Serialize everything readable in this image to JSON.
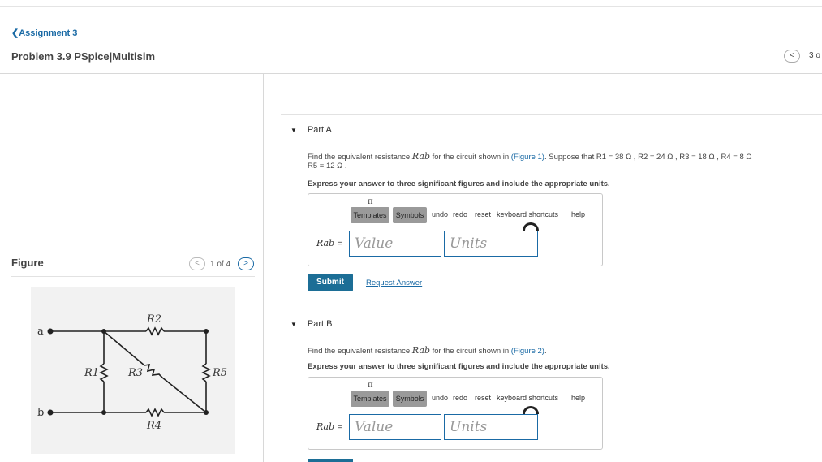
{
  "header": {
    "back_link": "❮Assignment 3",
    "title": "Problem 3.9 PSpice|Multisim",
    "nav_prev": "<",
    "nav_count": "3 o"
  },
  "figure_panel": {
    "label": "Figure",
    "prev": "<",
    "next": ">",
    "count": "1 of 4",
    "circuit": {
      "node_a": "a",
      "node_b": "b",
      "r1": "R1",
      "r2": "R2",
      "r3": "R3",
      "r4": "R4",
      "r5": "R5"
    }
  },
  "parts": [
    {
      "title": "Part A",
      "question_pre": "Find the equivalent resistance ",
      "question_mid": " for the circuit shown in ",
      "figure_link": "(Figure 1)",
      "question_post": ". Suppose that R1 = 38  Ω , R2 = 24  Ω , R3 = 18  Ω , R4 = 8  Ω ,",
      "question_line2": "R5 = 12  Ω .",
      "instruction": "Express your answer to three significant figures and include the appropriate units.",
      "rab": "Rab",
      "equals": "=",
      "value_placeholder": "Value",
      "units_placeholder": "Units",
      "submit": "Submit",
      "request_answer": "Request Answer"
    },
    {
      "title": "Part B",
      "question_pre": "Find the equivalent resistance ",
      "question_mid": " for the circuit shown in ",
      "figure_link": "(Figure 2)",
      "question_post": ".",
      "instruction": "Express your answer to three significant figures and include the appropriate units.",
      "rab": "Rab",
      "equals": "=",
      "value_placeholder": "Value",
      "units_placeholder": "Units"
    }
  ],
  "toolbar": {
    "templates": "Templates",
    "symbols": "Symbols",
    "undo": "undo",
    "redo": "redo",
    "reset": "reset",
    "keyboard_shortcuts": "keyboard shortcuts",
    "help": "help",
    "pi_glyph": "π"
  },
  "colors": {
    "link": "#1a6aa5",
    "submit_bg": "#1c6e96",
    "toolbar_button": "#9a9a9a",
    "figure_bg": "#f2f2f2"
  }
}
